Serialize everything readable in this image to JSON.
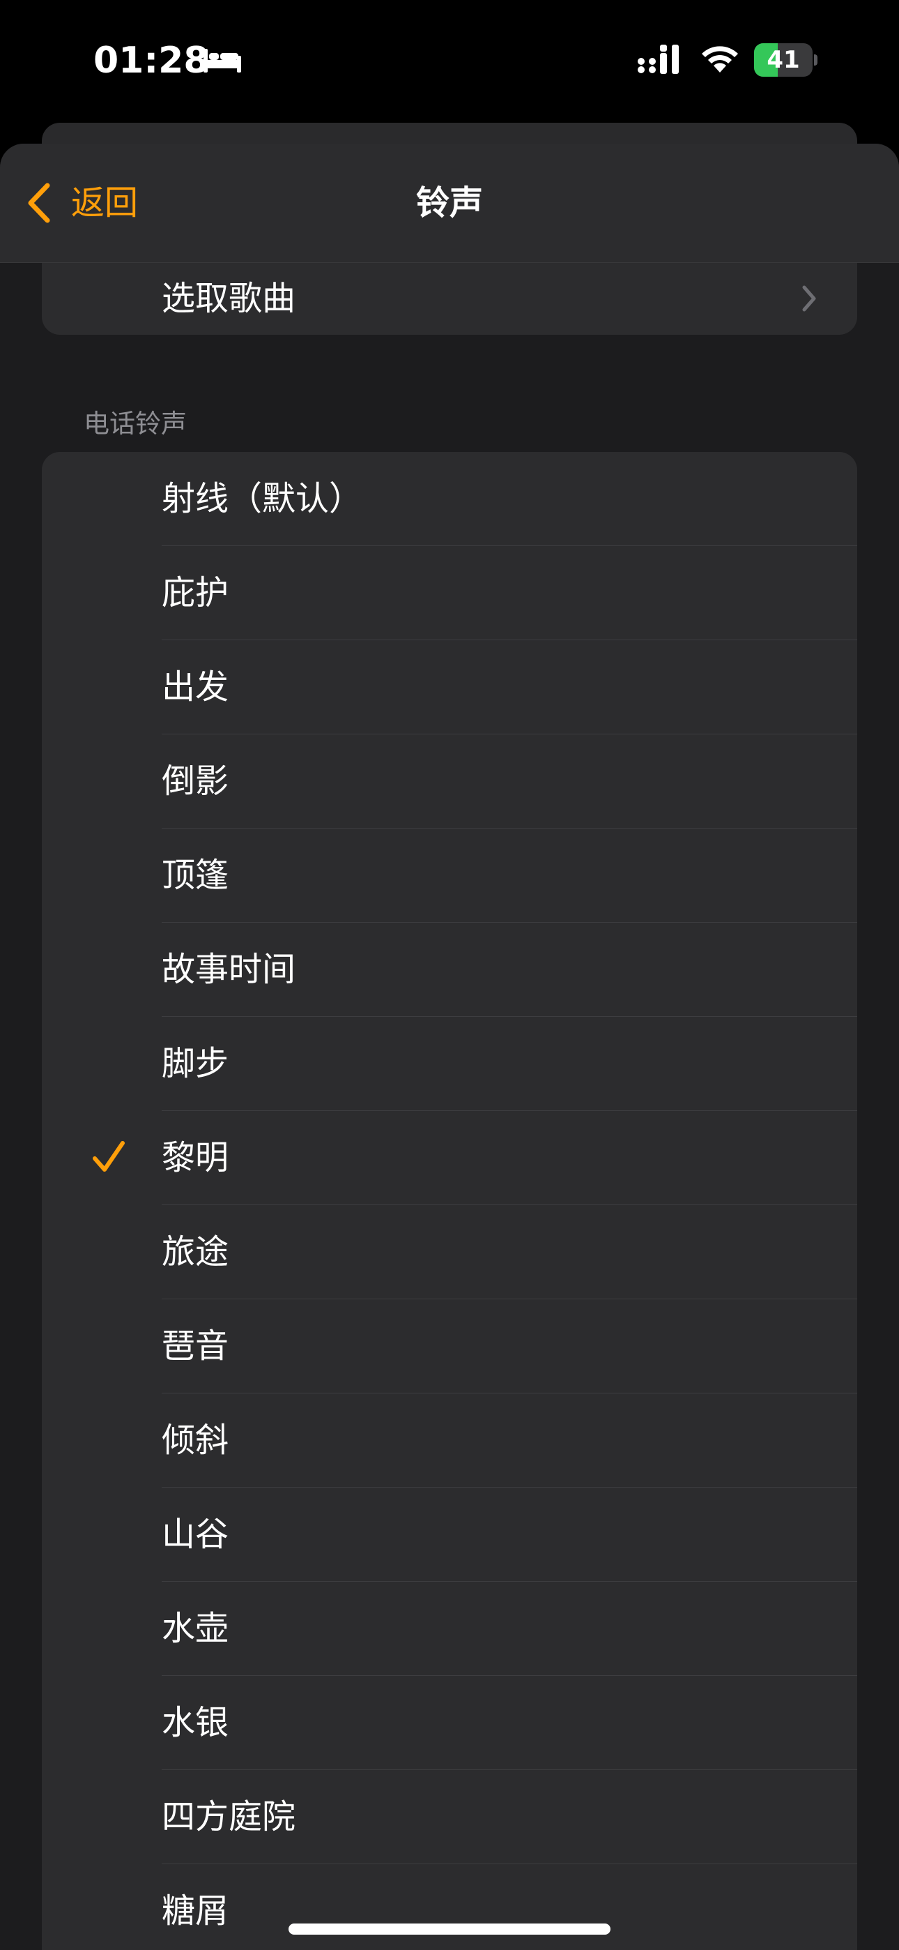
{
  "status_bar": {
    "time": "01:28",
    "battery_level": "41",
    "battery_fraction": 0.41,
    "icons": [
      "bed-icon",
      "cellular-signal-icon",
      "wifi-icon",
      "battery-charging-icon"
    ]
  },
  "nav": {
    "back_label": "返回",
    "title": "铃声"
  },
  "pick_song": {
    "label": "选取歌曲"
  },
  "section": {
    "header": "电话铃声"
  },
  "ringtones": [
    {
      "label": "射线（默认）",
      "selected": false
    },
    {
      "label": "庇护",
      "selected": false
    },
    {
      "label": "出发",
      "selected": false
    },
    {
      "label": "倒影",
      "selected": false
    },
    {
      "label": "顶篷",
      "selected": false
    },
    {
      "label": "故事时间",
      "selected": false
    },
    {
      "label": "脚步",
      "selected": false
    },
    {
      "label": "黎明",
      "selected": true
    },
    {
      "label": "旅途",
      "selected": false
    },
    {
      "label": "琶音",
      "selected": false
    },
    {
      "label": "倾斜",
      "selected": false
    },
    {
      "label": "山谷",
      "selected": false
    },
    {
      "label": "水壶",
      "selected": false
    },
    {
      "label": "水银",
      "selected": false
    },
    {
      "label": "四方庭院",
      "selected": false
    },
    {
      "label": "糖屑",
      "selected": false
    }
  ],
  "colors": {
    "accent": "#ff9f0a",
    "background": "#1c1c1e",
    "cell": "#2c2c2e",
    "battery_fill": "#34c759"
  }
}
